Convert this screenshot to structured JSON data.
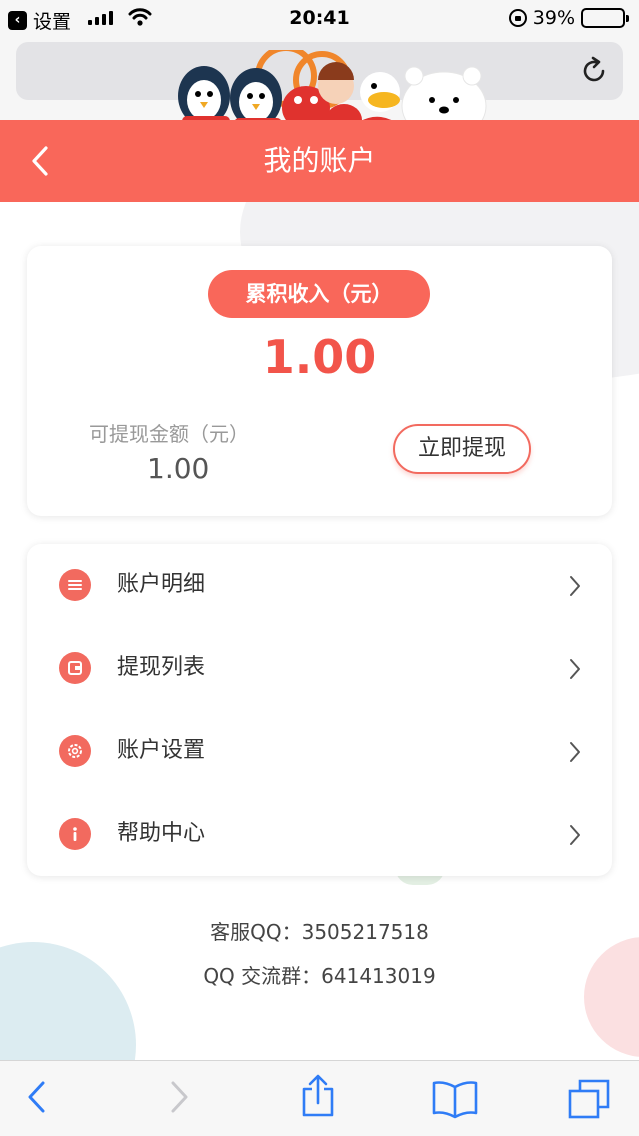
{
  "status_bar": {
    "back_app_label": "设置",
    "time": "20:41",
    "battery_text": "39%",
    "battery_level": 0.39
  },
  "header": {
    "title": "我的账户"
  },
  "earnings": {
    "badge_label": "累积收入（元）",
    "total": "1.00",
    "available_label": "可提现金额（元）",
    "available_value": "1.00",
    "withdraw_button": "立即提现"
  },
  "menu": {
    "items": [
      {
        "label": "账户明细",
        "icon": "list-icon"
      },
      {
        "label": "提现列表",
        "icon": "wallet-icon"
      },
      {
        "label": "账户设置",
        "icon": "gear-icon"
      },
      {
        "label": "帮助中心",
        "icon": "info-icon"
      }
    ]
  },
  "contact": {
    "service_qq": "客服QQ：3505217518",
    "qq_group": "QQ 交流群：641413019"
  },
  "colors": {
    "accent": "#f9675a",
    "accent_text": "#f2544a"
  }
}
